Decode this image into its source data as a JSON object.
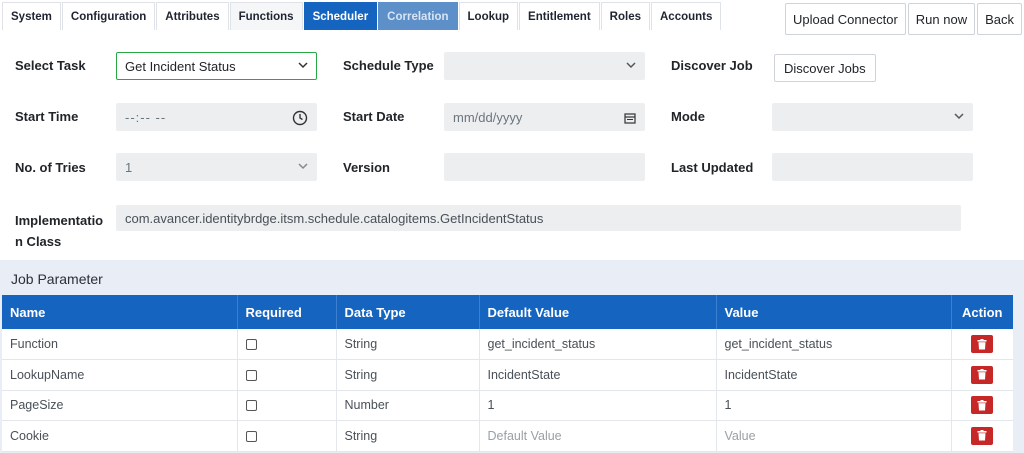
{
  "tabs": [
    {
      "label": "System"
    },
    {
      "label": "Configuration"
    },
    {
      "label": "Attributes"
    },
    {
      "label": "Functions"
    },
    {
      "label": "Scheduler"
    },
    {
      "label": "Correlation"
    },
    {
      "label": "Lookup"
    },
    {
      "label": "Entitlement"
    },
    {
      "label": "Roles"
    },
    {
      "label": "Accounts"
    }
  ],
  "actions": {
    "upload": "Upload Connector",
    "run": "Run now",
    "back": "Back"
  },
  "form": {
    "select_task_label": "Select Task",
    "select_task_value": "Get Incident Status",
    "schedule_type_label": "Schedule Type",
    "schedule_type_value": "",
    "discover_job_label": "Discover Job",
    "discover_jobs_button": "Discover Jobs",
    "start_time_label": "Start Time",
    "start_time_placeholder": "--:-- --",
    "start_date_label": "Start Date",
    "start_date_placeholder": "mm/dd/yyyy",
    "mode_label": "Mode",
    "mode_value": "",
    "tries_label": "No. of Tries",
    "tries_value": "1",
    "version_label": "Version",
    "version_value": "",
    "last_updated_label": "Last Updated",
    "last_updated_value": "",
    "impl_label_1": "Implementatio",
    "impl_label_2": "n Class",
    "impl_value": "com.avancer.identitybrdge.itsm.schedule.catalogitems.GetIncidentStatus"
  },
  "job_parameter": {
    "title": "Job Parameter",
    "columns": [
      "Name",
      "Required",
      "Data Type",
      "Default Value",
      "Value",
      "Action"
    ],
    "rows": [
      {
        "name": "Function",
        "type": "String",
        "default": "get_incident_status",
        "value": "get_incident_status"
      },
      {
        "name": "LookupName",
        "type": "String",
        "default": "IncidentState",
        "value": "IncidentState"
      },
      {
        "name": "PageSize",
        "type": "Number",
        "default": "1",
        "value": "1"
      },
      {
        "name": "Cookie",
        "type": "String",
        "default": "Default Value",
        "value": "Value"
      }
    ]
  },
  "colors": {
    "primary": "#1565c0",
    "danger": "#c62828",
    "section_bg": "#e9edf6"
  }
}
